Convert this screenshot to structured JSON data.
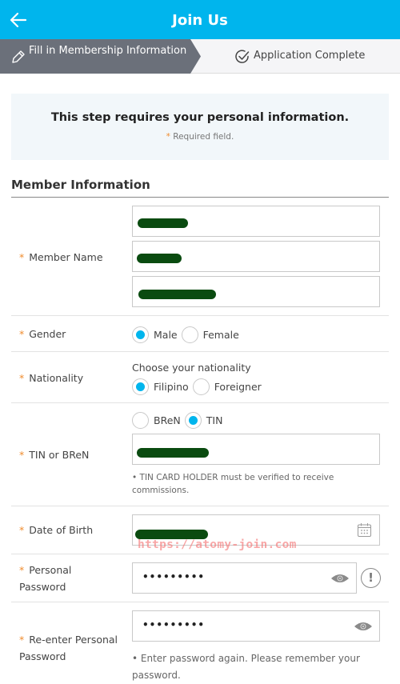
{
  "header": {
    "title": "Join Us",
    "back_icon": "arrow-left-icon",
    "color": "#00b5ed"
  },
  "steps": [
    {
      "label": "Fill in Membership Information",
      "icon": "pencil-icon",
      "active": true
    },
    {
      "label": "Application Complete",
      "icon": "check-circle-icon",
      "active": false
    }
  ],
  "notice": {
    "title": "This step requires your personal information.",
    "required_mark": "*",
    "required_text": "Required field."
  },
  "section": {
    "title": "Member Information"
  },
  "form": {
    "required_mark": "*",
    "member_name": {
      "label": "Member Name",
      "fields": [
        "[redacted]",
        "[redacted]",
        "[redacted]"
      ]
    },
    "gender": {
      "label": "Gender",
      "options": [
        {
          "label": "Male",
          "selected": true
        },
        {
          "label": "Female",
          "selected": false
        }
      ]
    },
    "nationality": {
      "label": "Nationality",
      "prompt": "Choose your nationality",
      "options": [
        {
          "label": "Filipino",
          "selected": true
        },
        {
          "label": "Foreigner",
          "selected": false
        }
      ]
    },
    "tin": {
      "label": "TIN or BReN",
      "options": [
        {
          "label": "BReN",
          "selected": false
        },
        {
          "label": "TIN",
          "selected": true
        }
      ],
      "value": "[redacted]",
      "hint": "• TIN CARD HOLDER must be verified to receive commissions."
    },
    "dob": {
      "label": "Date of Birth",
      "value": "[redacted]",
      "icon": "calendar-icon"
    },
    "password": {
      "label_line1": "Personal",
      "label_line2": "Password",
      "value": "•••••••••",
      "icon": "eye-icon",
      "info_icon": "!"
    },
    "password_confirm": {
      "label_line1": "Re-enter Personal",
      "label_line2": "Password",
      "value": "•••••••••",
      "icon": "eye-icon",
      "hint": "•  Enter password again. Please remember your password."
    }
  },
  "watermark": "https://atomy-join.com",
  "colors": {
    "accent": "#00b5ed",
    "required": "#f08c2e",
    "step_active_bg": "#6b707a",
    "notice_bg": "#f2f7fa"
  }
}
